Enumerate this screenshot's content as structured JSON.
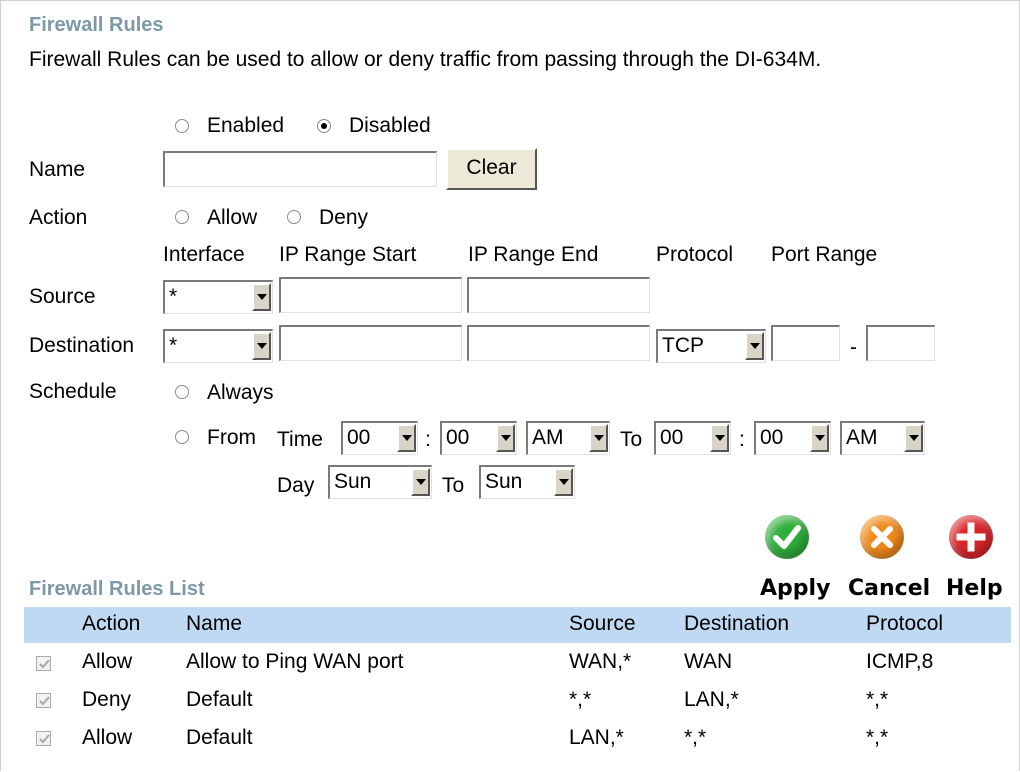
{
  "header": {
    "title": "Firewall Rules",
    "description": "Firewall Rules can be used to allow or deny traffic from passing through the DI-634M."
  },
  "enable_radio": {
    "enabled_label": "Enabled",
    "disabled_label": "Disabled",
    "selected": "Disabled"
  },
  "name_row": {
    "label": "Name",
    "value": "",
    "clear_label": "Clear"
  },
  "action_row": {
    "label": "Action",
    "allow_label": "Allow",
    "deny_label": "Deny",
    "selected": ""
  },
  "columns": {
    "interface": "Interface",
    "ip_start": "IP Range Start",
    "ip_end": "IP Range End",
    "protocol": "Protocol",
    "port_range": "Port Range"
  },
  "source_row": {
    "label": "Source",
    "interface": "*",
    "ip_start": "",
    "ip_end": ""
  },
  "destination_row": {
    "label": "Destination",
    "interface": "*",
    "ip_start": "",
    "ip_end": "",
    "protocol": "TCP",
    "port_start": "",
    "port_separator": "-",
    "port_end": ""
  },
  "schedule": {
    "label": "Schedule",
    "always_label": "Always",
    "from_label": "From",
    "time_label": "Time",
    "from_hour": "00",
    "colon1": ":",
    "from_minute": "00",
    "from_ampm": "AM",
    "to_label": "To",
    "to_hour": "00",
    "colon2": ":",
    "to_minute": "00",
    "to_ampm": "AM",
    "day_label": "Day",
    "from_day": "Sun",
    "day_to_label": "To",
    "to_day": "Sun"
  },
  "actions": {
    "apply_label": "Apply",
    "cancel_label": "Cancel",
    "help_label": "Help"
  },
  "colors": {
    "apply": "#2fae3a",
    "cancel": "#f08a1c",
    "help": "#d9252a",
    "heading": "#7d98a6",
    "table_header": "#c0d9f3"
  },
  "list": {
    "title": "Firewall Rules List",
    "headers": {
      "action": "Action",
      "name": "Name",
      "source": "Source",
      "destination": "Destination",
      "protocol": "Protocol"
    },
    "rows": [
      {
        "checked": true,
        "action": "Allow",
        "name": "Allow to Ping WAN port",
        "source": "WAN,*",
        "destination": "WAN",
        "protocol": "ICMP,8"
      },
      {
        "checked": true,
        "action": "Deny",
        "name": "Default",
        "source": "*,*",
        "destination": "LAN,*",
        "protocol": "*,*"
      },
      {
        "checked": true,
        "action": "Allow",
        "name": "Default",
        "source": "LAN,*",
        "destination": "*,*",
        "protocol": "*,*"
      }
    ]
  }
}
